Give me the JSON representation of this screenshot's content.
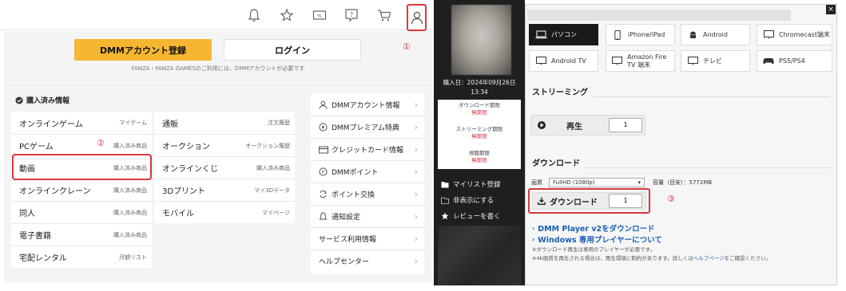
{
  "left": {
    "topbar_icons": [
      "bell-icon",
      "star-icon",
      "coupon-icon",
      "help-icon",
      "cart-icon",
      "user-icon"
    ],
    "register_label": "DMMアカウント登録",
    "login_label": "ログイン",
    "login_note": "FANZA・FANZA GAMESのご利用には、DMMアカウントが必要です",
    "marker_1": "①",
    "marker_2": "②",
    "purchased_title": "購入済み情報",
    "col1": [
      {
        "label": "オンラインゲーム",
        "sub": "マイゲーム"
      },
      {
        "label": "PCゲーム",
        "sub": "購入済み商品"
      },
      {
        "label": "動画",
        "sub": "購入済み商品"
      },
      {
        "label": "オンラインクレーン",
        "sub": "購入済み商品"
      },
      {
        "label": "同人",
        "sub": "購入済み商品"
      },
      {
        "label": "電子書籍",
        "sub": "購入済み商品"
      },
      {
        "label": "宅配レンタル",
        "sub": "月額リスト"
      }
    ],
    "col2": [
      {
        "label": "通販",
        "sub": "注文履歴"
      },
      {
        "label": "オークション",
        "sub": "オークション履歴"
      },
      {
        "label": "オンラインくじ",
        "sub": "購入済み商品"
      },
      {
        "label": "3Dプリント",
        "sub": "マイ3Dデータ"
      },
      {
        "label": "モバイル",
        "sub": "マイページ"
      }
    ],
    "account_menu": [
      {
        "label": "DMMアカウント情報",
        "icon": "person-icon"
      },
      {
        "label": "DMMプレミアム特典",
        "icon": "premium-icon"
      },
      {
        "label": "クレジットカード情報",
        "icon": "credit-card-icon"
      },
      {
        "label": "DMMポイント",
        "icon": "point-icon"
      },
      {
        "label": "ポイント交換",
        "icon": "exchange-icon"
      },
      {
        "label": "通知設定",
        "icon": "bell-icon"
      },
      {
        "label": "サービス利用情報",
        "icon": ""
      },
      {
        "label": "ヘルプセンター",
        "icon": ""
      }
    ]
  },
  "right": {
    "purchase_date": "購入日：2024年09月26日 13:34",
    "rights": [
      {
        "label": "ダウンロード期限",
        "value": "無期限"
      },
      {
        "label": "ストリーミング期限",
        "value": "無期限"
      },
      {
        "label": "視聴期限",
        "value": "無期限"
      }
    ],
    "sidebar_links": [
      {
        "label": "マイリスト登録",
        "icon": "folder-icon"
      },
      {
        "label": "非表示にする",
        "icon": "hide-icon"
      },
      {
        "label": "レビューを書く",
        "icon": "star-icon"
      }
    ],
    "devices": [
      {
        "label": "パソコン",
        "icon": "laptop-icon",
        "active": true
      },
      {
        "label": "iPhone/iPad",
        "icon": "phone-icon",
        "active": false
      },
      {
        "label": "Android",
        "icon": "android-icon",
        "active": false
      },
      {
        "label": "Chromecast端末",
        "icon": "monitor-icon",
        "active": false
      },
      {
        "label": "Android TV",
        "icon": "monitor-icon",
        "active": false
      },
      {
        "label": "Amazon Fire TV 端末",
        "icon": "monitor-icon",
        "active": false
      },
      {
        "label": "テレビ",
        "icon": "monitor-icon",
        "active": false
      },
      {
        "label": "PS5/PS4",
        "icon": "gamepad-icon",
        "active": false
      }
    ],
    "streaming_title": "ストリーミング",
    "play_label": "再生",
    "play_qty": "1",
    "download_title": "ダウンロード",
    "quality_label": "画質",
    "quality_value": "FullHD (1080p)",
    "filesize": "容量（目安）：5772MB",
    "download_label": "ダウンロード",
    "download_qty": "1",
    "marker_3": "③",
    "link_player": "DMM Player v2をダウンロード",
    "link_windows": "Windows 専用プレイヤーについて",
    "note1": "※ダウンロード再生は専用のプレイヤーが必要です。",
    "note2_pre": "※4K画質を再生される場合は、再生環境に制約があります。詳しくは",
    "note2_link": "ヘルプページ",
    "note2_post": "をご確認ください。",
    "close_label": "×"
  }
}
